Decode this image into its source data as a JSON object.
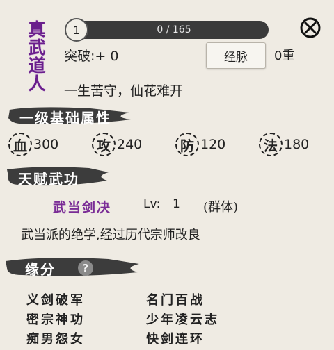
{
  "character": {
    "name_chars": [
      "真",
      "武",
      "道",
      "人"
    ],
    "level": "1",
    "exp_text": "0 / 165",
    "exp_fraction": 0.0,
    "breakthrough_label": "突破:",
    "breakthrough_value": "+ 0",
    "meridian_button": "经脉",
    "meridian_layers": "0重",
    "motto": "一生苦守，仙花难开"
  },
  "sections": {
    "base_attrs": "一级基础属性",
    "talent_skill": "天赋武功",
    "fate": "缘分"
  },
  "attributes": [
    {
      "icon_char": "血",
      "value": "300"
    },
    {
      "icon_char": "攻",
      "value": "240"
    },
    {
      "icon_char": "防",
      "value": "120"
    },
    {
      "icon_char": "法",
      "value": "180"
    }
  ],
  "skill": {
    "name": "武当剑决",
    "lv_label": "Lv:",
    "lv_value": "1",
    "type": "(群体)",
    "description": "武当派的绝学,经过历代宗师改良"
  },
  "fates": [
    "义剑破军",
    "名门百战",
    "密宗神功",
    "少年凌云志",
    "痴男怨女",
    "快剑连环"
  ],
  "icons": {
    "close": "close-icon",
    "help": "help-icon"
  },
  "colors": {
    "accent": "#6a1f8c",
    "bar_bg": "#3a3a3a",
    "brush": "#3c3c3c"
  }
}
